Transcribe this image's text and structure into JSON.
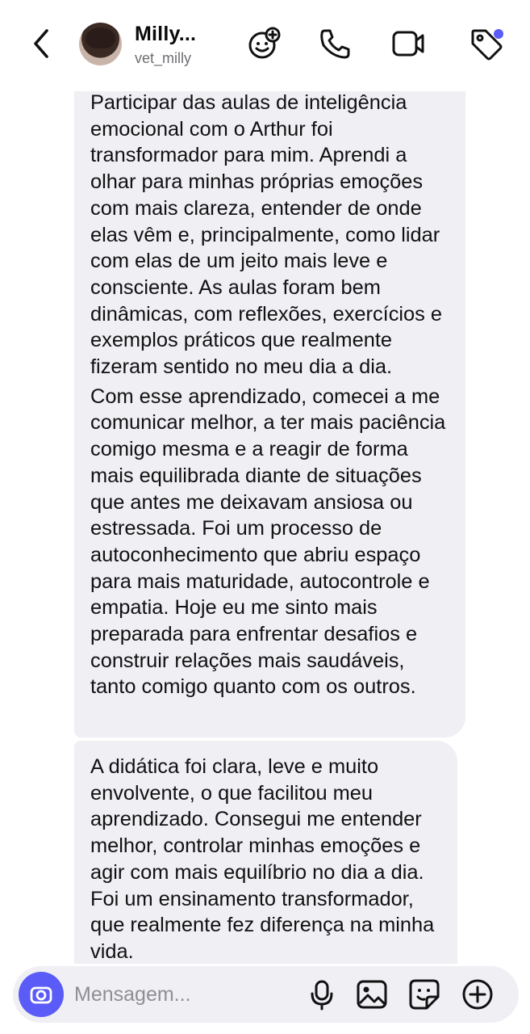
{
  "header": {
    "contact_name": "Milly...",
    "contact_handle": "vet_milly"
  },
  "messages": [
    {
      "paragraphs": [
        "Participar das aulas de inteligência emocional com o Arthur foi transformador para mim. Aprendi a olhar para minhas próprias emoções com mais clareza, entender de onde elas vêm e, principalmente, como lidar com elas de um jeito mais leve e consciente. As aulas foram bem dinâmicas, com reflexões, exercícios e exemplos práticos que realmente fizeram sentido no meu dia a dia.",
        "Com esse aprendizado, comecei a me comunicar melhor, a ter mais paciência comigo mesma e a reagir de forma mais equilibrada diante de situações que antes me deixavam ansiosa ou estressada. Foi um processo de autoconhecimento que abriu espaço para mais maturidade, autocontrole e empatia. Hoje eu me sinto mais preparada para enfrentar desafios e construir relações mais saudáveis, tanto comigo quanto com os outros."
      ]
    },
    {
      "paragraphs": [
        "A didática foi clara, leve e muito envolvente, o que facilitou meu aprendizado. Consegui me entender melhor, controlar minhas emoções e agir com mais equilíbrio no dia a dia. Foi um ensinamento transformador, que realmente fez diferença na minha vida."
      ]
    }
  ],
  "composer": {
    "placeholder": "Mensagem...",
    "value": ""
  },
  "icons": {
    "back": "chevron-left-icon",
    "effects": "sparkle-face-icon",
    "call": "phone-icon",
    "video": "video-camera-icon",
    "tag": "tag-icon",
    "camera": "camera-icon",
    "mic": "microphone-icon",
    "gallery": "gallery-icon",
    "sticker": "sticker-icon",
    "plus": "plus-circle-icon"
  },
  "colors": {
    "accent": "#5b5bf7",
    "bubble_bg": "#efeff4",
    "notification_dot": "#5b5bf7"
  }
}
